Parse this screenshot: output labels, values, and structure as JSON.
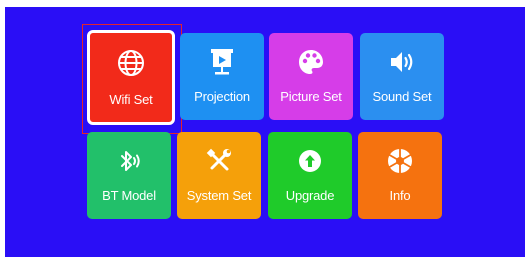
{
  "menu": {
    "tiles": [
      {
        "label": "Wifi Set",
        "icon": "globe-icon",
        "color": "#f22a1a"
      },
      {
        "label": "Projection",
        "icon": "projector-screen-icon",
        "color": "#1e90f2"
      },
      {
        "label": "Picture Set",
        "icon": "palette-icon",
        "color": "#d63de8"
      },
      {
        "label": "Sound Set",
        "icon": "speaker-icon",
        "color": "#2b8ff0"
      },
      {
        "label": "BT Model",
        "icon": "bluetooth-icon",
        "color": "#22c06a"
      },
      {
        "label": "System Set",
        "icon": "tools-icon",
        "color": "#f5a00a"
      },
      {
        "label": "Upgrade",
        "icon": "upgrade-arrow-icon",
        "color": "#1fcb2a"
      },
      {
        "label": "Info",
        "icon": "aperture-icon",
        "color": "#f5720f"
      }
    ],
    "selected": "Wifi Set",
    "background": "#2a0ef6",
    "focus_color": "#e3242b"
  }
}
